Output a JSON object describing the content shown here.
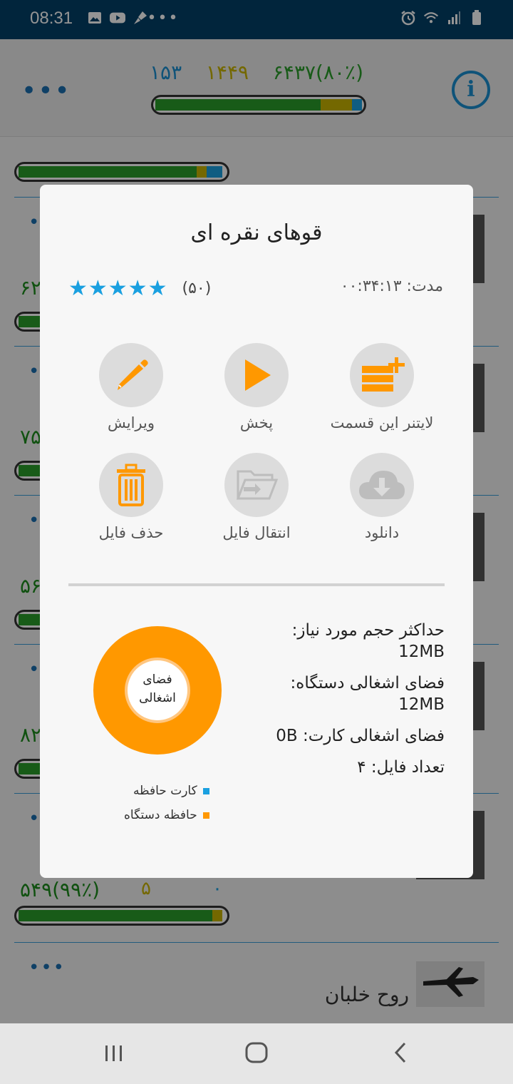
{
  "status_bar": {
    "time": "08:31",
    "left_icons": [
      "image-icon",
      "youtube-icon",
      "cleaner-icon"
    ],
    "overflow": "•••",
    "right_icons": [
      "alarm-icon",
      "wifi-icon",
      "signal-icon",
      "battery-icon"
    ]
  },
  "header": {
    "stat_green": "۶۴۳۷(۸۰٪)",
    "stat_yellow": "۱۴۴۹",
    "stat_blue": "۱۵۳",
    "progress": {
      "green": 0.8,
      "yellow": 0.15,
      "blue": 0.05
    },
    "more": "•••",
    "info": "i"
  },
  "background_list": {
    "rows": [
      {
        "number": "",
        "dots": ""
      },
      {
        "number": "۶۲",
        "dots": "•••"
      },
      {
        "number": "۷۵",
        "dots": "•••"
      },
      {
        "number": "۵۶",
        "dots": "•••"
      },
      {
        "number": "۸۲",
        "dots": "•••"
      },
      {
        "number": "۵۴۹(۹۹٪)",
        "yellow": "۵",
        "blue": "۰",
        "dots": "•••"
      }
    ],
    "last_row_title": "روح خلبان"
  },
  "dialog": {
    "title": "قوهای نقره ای",
    "duration_label": "مدت:",
    "duration_value": "۰۰:۳۴:۱۳",
    "stars_text": "★★★★★",
    "rating_count": "(۵۰)",
    "actions": [
      {
        "label": "لایتنر این قسمت",
        "icon": "leitner-add-icon"
      },
      {
        "label": "پخش",
        "icon": "play-icon"
      },
      {
        "label": "ویرایش",
        "icon": "pencil-icon"
      },
      {
        "label": "دانلود",
        "icon": "cloud-download-icon"
      },
      {
        "label": "انتقال فایل",
        "icon": "folder-move-icon"
      },
      {
        "label": "حذف فایل",
        "icon": "trash-icon"
      }
    ],
    "info": {
      "max_size_label": "حداکثر حجم مورد نیاز:",
      "max_size_value": "12MB",
      "device_space_label": "فضای اشغالی دستگاه:",
      "device_space_value": "12MB",
      "card_space": "فضای اشغالی کارت: 0B",
      "file_count": "تعداد فایل: ۴"
    },
    "donut": {
      "center_label_1": "فضای",
      "center_label_2": "اشغالی",
      "device_fraction": 1.0,
      "card_fraction": 0.0
    },
    "legend": [
      {
        "label": "کارت حافظه",
        "color": "#1aa0e0"
      },
      {
        "label": "حافظه دستگاه",
        "color": "#ff9800"
      }
    ]
  },
  "colors": {
    "accent_orange": "#ff9800",
    "accent_blue": "#1aa0e0",
    "green": "#2a9d2a",
    "yellow": "#c8b400",
    "status_bar": "#024068"
  }
}
